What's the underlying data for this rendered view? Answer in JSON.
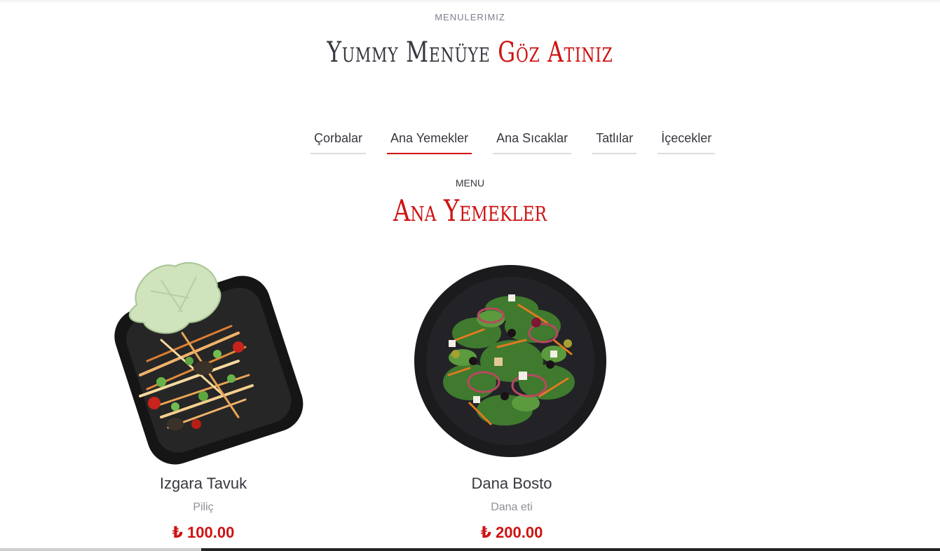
{
  "section": {
    "eyebrow": "MENULERIMIZ",
    "headline_main": "Yummy Menüye",
    "headline_accent": "Göz Atınız"
  },
  "tabs": [
    {
      "label": "Çorbalar",
      "active": false
    },
    {
      "label": "Ana Yemekler",
      "active": true
    },
    {
      "label": "Ana Sıcaklar",
      "active": false
    },
    {
      "label": "Tatlılar",
      "active": false
    },
    {
      "label": "İçecekler",
      "active": false
    }
  ],
  "menu": {
    "label": "MENU",
    "title": "Ana Yemekler",
    "items": [
      {
        "name": "Izgara Tavuk",
        "desc": "Piliç",
        "price": "₺ 100.00",
        "image": "grilled-chicken-salad-plate"
      },
      {
        "name": "Dana Bosto",
        "desc": "Dana eti",
        "price": "₺ 200.00",
        "image": "green-salad-bowl"
      }
    ]
  },
  "colors": {
    "accent": "#ce1212",
    "text": "#37373f",
    "muted": "#8f8f98"
  }
}
